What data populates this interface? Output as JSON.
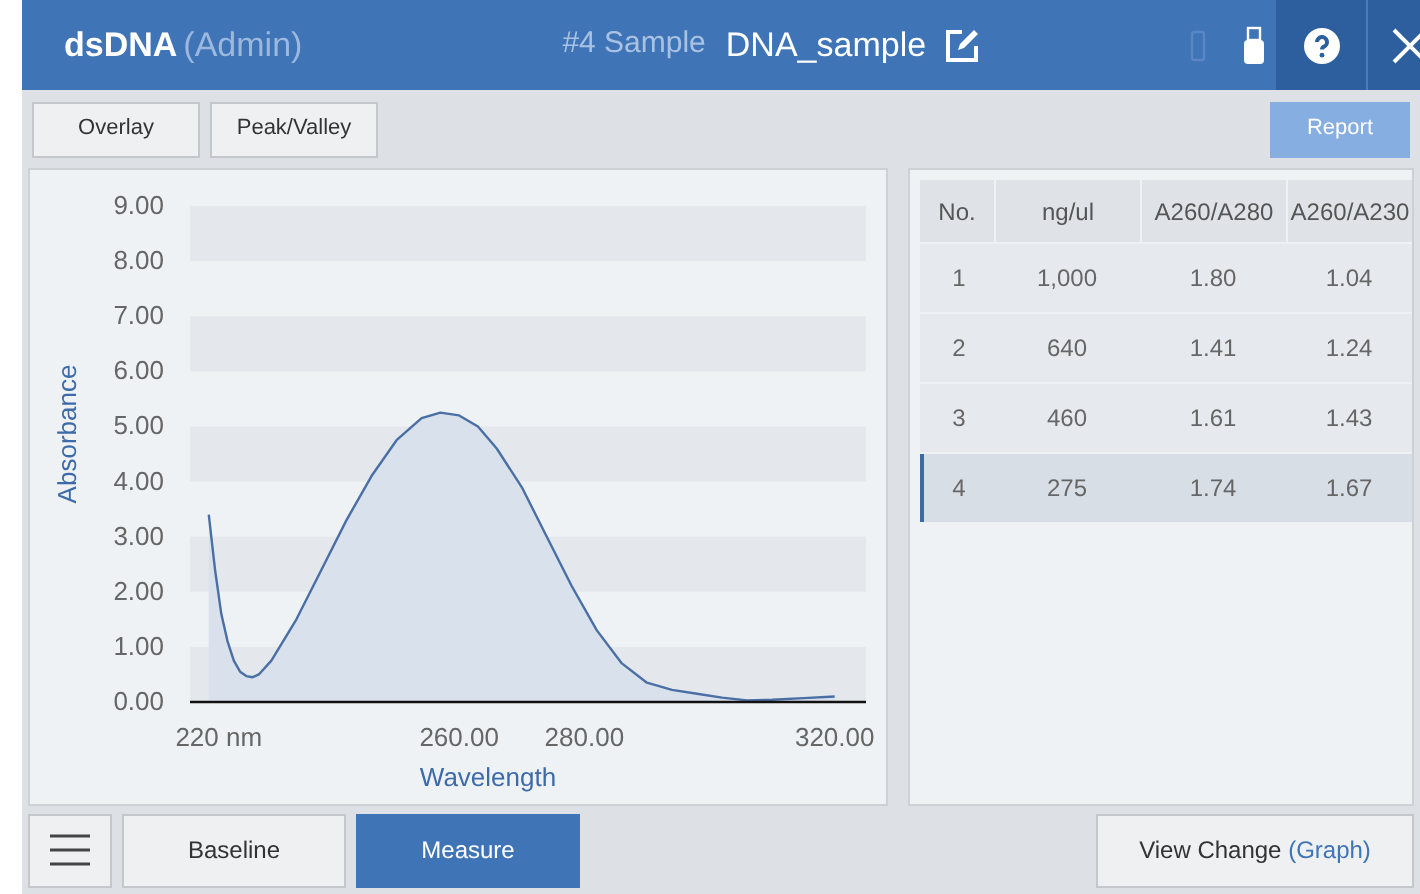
{
  "header": {
    "app": "dsDNA",
    "role": "(Admin)",
    "sample_number": "#4 Sample",
    "sample_name": "DNA_sample"
  },
  "toolbar": {
    "buttons": [
      "Overlay",
      "Peak/Valley"
    ],
    "report": "Report"
  },
  "chart": {
    "chart_data": {
      "type": "area",
      "xlabel": "Wavelength",
      "ylabel": "Absorbance",
      "x": [
        220,
        221,
        222,
        223,
        224,
        225,
        226,
        227,
        228,
        230,
        234,
        238,
        242,
        246,
        250,
        254,
        257,
        260,
        263,
        266,
        270,
        274,
        278,
        282,
        286,
        290,
        294,
        298,
        302,
        306,
        310,
        315,
        320
      ],
      "series": [
        {
          "color": "#4a6fa5",
          "values": [
            3.4,
            2.4,
            1.6,
            1.1,
            0.75,
            0.55,
            0.47,
            0.45,
            0.5,
            0.75,
            1.5,
            2.4,
            3.3,
            4.1,
            4.75,
            5.15,
            5.25,
            5.2,
            5.0,
            4.6,
            3.9,
            3.0,
            2.1,
            1.3,
            0.7,
            0.35,
            0.22,
            0.15,
            0.08,
            0.03,
            0.04,
            0.07,
            0.1
          ]
        }
      ],
      "xlim": [
        217,
        325
      ],
      "ylim": [
        0,
        9
      ],
      "xticks": [
        {
          "value": 220,
          "label": "220 nm"
        },
        {
          "value": 260,
          "label": "260.00"
        },
        {
          "value": 280,
          "label": "280.00"
        },
        {
          "value": 320,
          "label": "320.00"
        }
      ],
      "yticks": [
        {
          "value": 0,
          "label": "0.00"
        },
        {
          "value": 1,
          "label": "1.00"
        },
        {
          "value": 2,
          "label": "2.00"
        },
        {
          "value": 3,
          "label": "3.00"
        },
        {
          "value": 4,
          "label": "4.00"
        },
        {
          "value": 5,
          "label": "5.00"
        },
        {
          "value": 6,
          "label": "6.00"
        },
        {
          "value": 7,
          "label": "7.00"
        },
        {
          "value": 8,
          "label": "8.00"
        },
        {
          "value": 9,
          "label": "9.00"
        }
      ]
    }
  },
  "table": {
    "columns": [
      "No.",
      "ng/ul",
      "A260/A280",
      "A260/A230"
    ],
    "rows": [
      {
        "cells": [
          "1",
          "1,000",
          "1.80",
          "1.04"
        ],
        "selected": false
      },
      {
        "cells": [
          "2",
          "640",
          "1.41",
          "1.24"
        ],
        "selected": false
      },
      {
        "cells": [
          "3",
          "460",
          "1.61",
          "1.43"
        ],
        "selected": false
      },
      {
        "cells": [
          "4",
          "275",
          "1.74",
          "1.67"
        ],
        "selected": true
      }
    ]
  },
  "footer": {
    "buttons": [
      {
        "label": "Baseline",
        "selected": false
      },
      {
        "label": "Measure",
        "selected": true
      }
    ],
    "view_change": "View Change",
    "view_mode": "(Graph)"
  }
}
